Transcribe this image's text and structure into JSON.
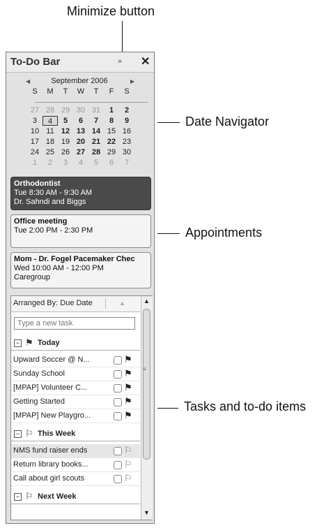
{
  "callouts": {
    "minimize": "Minimize button",
    "date_navigator": "Date Navigator",
    "appointments": "Appointments",
    "tasks": "Tasks and to-do items"
  },
  "todo_bar": {
    "title": "To-Do Bar",
    "minimize_glyph": "»",
    "close_glyph": "✕"
  },
  "calendar": {
    "month": "September 2006",
    "prev_glyph": "◀",
    "next_glyph": "▶",
    "weekdays": [
      "S",
      "M",
      "T",
      "W",
      "T",
      "F",
      "S"
    ],
    "weeks": [
      [
        "27",
        "28",
        "29",
        "30",
        "31",
        "1",
        "2"
      ],
      [
        "3",
        "4",
        "5",
        "6",
        "7",
        "8",
        "9"
      ],
      [
        "10",
        "11",
        "12",
        "13",
        "14",
        "15",
        "16"
      ],
      [
        "17",
        "18",
        "19",
        "20",
        "21",
        "22",
        "23"
      ],
      [
        "24",
        "25",
        "26",
        "27",
        "28",
        "29",
        "30"
      ],
      [
        "1",
        "2",
        "3",
        "4",
        "5",
        "6",
        "7"
      ]
    ],
    "selected_day": "4"
  },
  "appointments": [
    {
      "subject": "Orthodontist",
      "time": "Tue 8:30 AM - 9:30 AM",
      "location": "Dr. Sahndi and Biggs"
    },
    {
      "subject": "Office meeting",
      "time": "Tue 2:00 PM - 2:30 PM",
      "location": ""
    },
    {
      "subject": "Mom - Dr. Fogel Pacemaker Chec",
      "time": "Wed 10:00 AM - 12:00 PM",
      "location": "Caregroup"
    }
  ],
  "tasks": {
    "arranged_by": "Arranged By: Due Date",
    "new_task_placeholder": "Type a new task",
    "groups": [
      {
        "label": "Today",
        "items": [
          "Upward Soccer @ N...",
          "Sunday School",
          "[MPAP] Volunteer C...",
          "Getting Started",
          "[MPAP] New Playgro..."
        ]
      },
      {
        "label": "This Week",
        "items": [
          "NMS fund raiser ends",
          "Return library books...",
          "Call about girl scouts"
        ]
      },
      {
        "label": "Next Week",
        "items": []
      }
    ]
  }
}
